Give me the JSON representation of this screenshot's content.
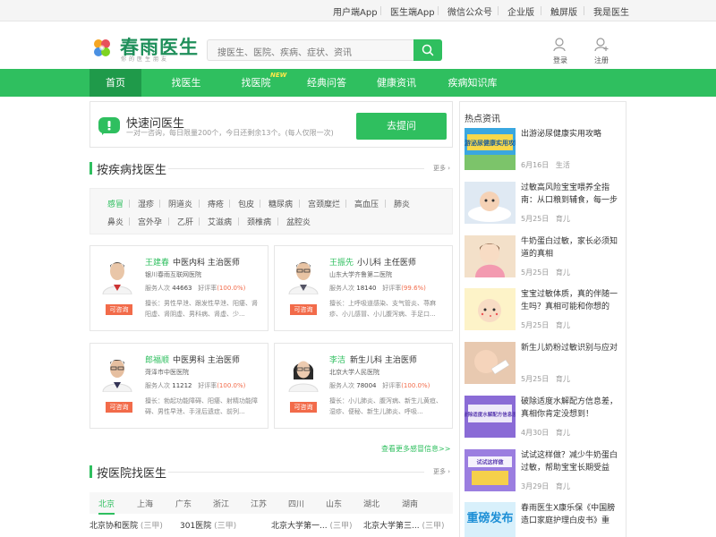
{
  "topbar": {
    "links": [
      "用户端App",
      "医生端App",
      "微信公众号",
      "企业版",
      "触屏版",
      "我是医生"
    ]
  },
  "header": {
    "logo_text": "春雨医生",
    "logo_sub": "你的医生朋友",
    "search_placeholder": "搜医生、医院、疾病、症状、资讯",
    "login": "登录",
    "register": "注册"
  },
  "nav": {
    "items": [
      "首页",
      "找医生",
      "找医院",
      "经典问答",
      "健康资讯",
      "疾病知识库"
    ],
    "new_badge": "NEW"
  },
  "quick_ask": {
    "title": "快速问医生",
    "subtitle": "一对一咨询，每日限量200个，今日还剩余13个。(每人仅限一次)",
    "button": "去提问"
  },
  "disease_section": {
    "title": "按疾病找医生",
    "more": "更多",
    "tags_row1": [
      "感冒",
      "湿疹",
      "阴道炎",
      "痔疮",
      "包皮",
      "糖尿病",
      "宫颈糜烂",
      "高血压",
      "肺炎"
    ],
    "tags_row2": [
      "鼻炎",
      "宫外孕",
      "乙肝",
      "艾滋病",
      "颈椎病",
      "盆腔炎"
    ]
  },
  "doctors": [
    {
      "name": "王建春",
      "title": "中医内科  主治医师",
      "hospital": "银川春雨互联网医院",
      "served_label": "服务人次",
      "served": "44663",
      "rating_label": "好评率",
      "rating": "(100.0%)",
      "skill": "擅长：男性早泄、跟发性早泄、阳痿、肾阳虚、肾阴虚、男科病、肾虚、少...",
      "btn": "可咨询"
    },
    {
      "name": "王振先",
      "title": "小儿科  主任医师",
      "hospital": "山东大学齐鲁第二医院",
      "served_label": "服务人次",
      "served": "18140",
      "rating_label": "好评率",
      "rating": "(99.6%)",
      "skill": "擅长：上呼吸道感染、支气管炎、荨麻疹、小儿感冒、小儿腹泻病、手足口...",
      "btn": "可咨询"
    },
    {
      "name": "郎福顺",
      "title": "中医男科  主治医师",
      "hospital": "菏泽市中医医院",
      "served_label": "服务人次",
      "served": "11212",
      "rating_label": "好评率",
      "rating": "(100.0%)",
      "skill": "擅长：勃起功能障碍、阳痿、射精功能障碍、男性早泄、手淫后遗症、前列...",
      "btn": "可咨询"
    },
    {
      "name": "李洁",
      "title": "新生儿科  主治医师",
      "hospital": "北京大学人民医院",
      "served_label": "服务人次",
      "served": "78004",
      "rating_label": "好评率",
      "rating": "(100.0%)",
      "skill": "擅长：小儿肺炎、腹泻病、新生儿黄疸、湿疹、便秘、新生儿肺炎、呼吸...",
      "btn": "可咨询"
    }
  ],
  "more_link": "查看更多感冒信息>>",
  "hospital_section": {
    "title": "按医院找医生",
    "more": "更多",
    "cities": [
      "北京",
      "上海",
      "广东",
      "浙江",
      "江苏",
      "四川",
      "山东",
      "湖北",
      "湖南"
    ],
    "hospitals": [
      {
        "name": "北京协和医院",
        "level": "(三甲)"
      },
      {
        "name": "301医院",
        "level": "(三甲)"
      },
      {
        "name": "北京大学第一...",
        "level": "(三甲)"
      },
      {
        "name": "北京大学第三...",
        "level": "(三甲)"
      }
    ]
  },
  "news": {
    "title": "热点资讯",
    "items": [
      {
        "title": "出游泌尿健康实用攻略",
        "date": "6月16日",
        "cat": "生活",
        "thumb_text": "出游泌尿健康实用攻略"
      },
      {
        "title": "过敏高风险宝宝喂养全指南：从口粮到辅食，每一步都...",
        "date": "5月25日",
        "cat": "育儿",
        "thumb_text": ""
      },
      {
        "title": "牛奶蛋白过敏，家长必须知道的真相",
        "date": "5月25日",
        "cat": "育儿",
        "thumb_text": ""
      },
      {
        "title": "宝宝过敏体质，真的伴随一生吗？真相可能和你想的不...",
        "date": "5月25日",
        "cat": "育儿",
        "thumb_text": ""
      },
      {
        "title": "新生儿奶粉过敏识别与应对",
        "date": "5月25日",
        "cat": "育儿",
        "thumb_text": ""
      },
      {
        "title": "破除适度水解配方信息差，真相你肯定没想到！",
        "date": "4月30日",
        "cat": "育儿",
        "thumb_text": "破除适度水解配方信息差"
      },
      {
        "title": "试试这样做？减少牛奶蛋白过敏，帮助宝宝长期受益",
        "date": "3月29日",
        "cat": "育儿",
        "thumb_text": "试试这样做"
      },
      {
        "title": "春雨医生X康乐保《中国膀造口家庭护理白皮书》重磅...",
        "date": "",
        "cat": "",
        "thumb_text": "重磅发布"
      }
    ]
  }
}
